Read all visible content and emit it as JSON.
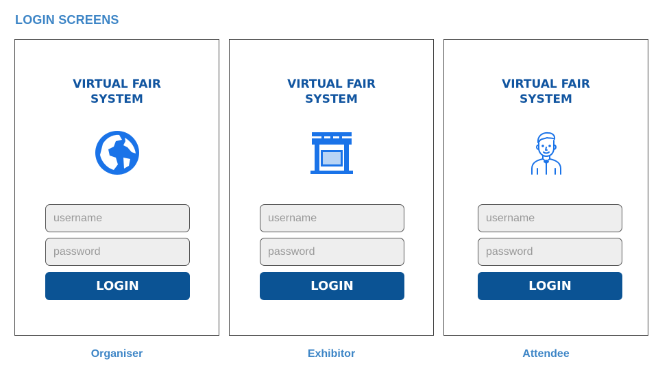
{
  "page": {
    "title": "LOGIN SCREENS"
  },
  "colors": {
    "accent": "#3d85c6",
    "heading": "#1155a0",
    "button": "#0b5394",
    "icon": "#1a73e8",
    "field_bg": "#eeeeee"
  },
  "panels": [
    {
      "heading_line1": "VIRTUAL FAIR",
      "heading_line2": "SYSTEM",
      "icon": "globe-icon",
      "username_placeholder": "username",
      "password_placeholder": "password",
      "login_label": "LOGIN",
      "role": "Organiser"
    },
    {
      "heading_line1": "VIRTUAL FAIR",
      "heading_line2": "SYSTEM",
      "icon": "booth-icon",
      "username_placeholder": "username",
      "password_placeholder": "password",
      "login_label": "LOGIN",
      "role": "Exhibitor"
    },
    {
      "heading_line1": "VIRTUAL FAIR",
      "heading_line2": "SYSTEM",
      "icon": "person-icon",
      "username_placeholder": "username",
      "password_placeholder": "password",
      "login_label": "LOGIN",
      "role": "Attendee"
    }
  ]
}
